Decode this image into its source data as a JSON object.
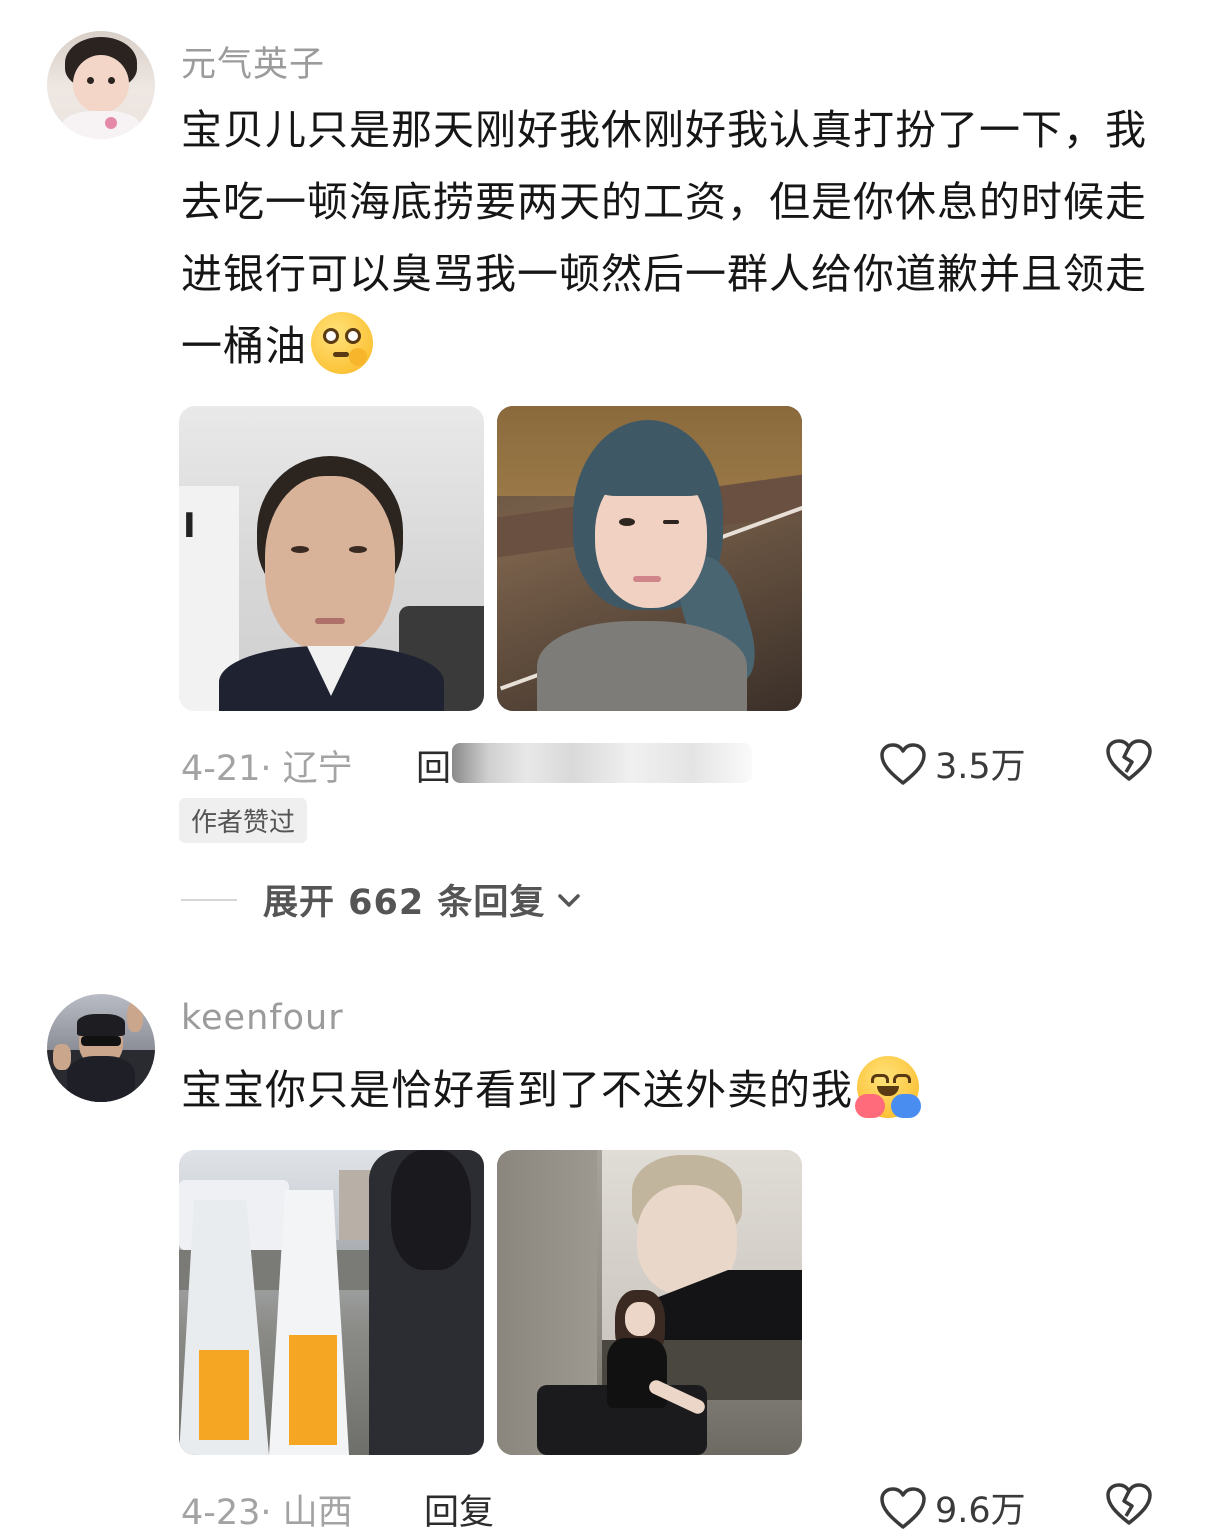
{
  "comments": [
    {
      "username": "元气英子",
      "text": "宝贝儿只是那天刚好我休刚好我认真打扮了一下，我去吃一顿海底捞要两天的工资，但是你休息的时候走进银行可以臭骂我一顿然后一群人给你道歉并且领走一桶油",
      "emoji": "face-with-monocle-emoji",
      "images": [
        "selfie-in-office-photo",
        "selfie-blue-hair-photo"
      ],
      "date_location": "4-21· 辽宁",
      "reply_label": "回",
      "likes": "3.5万",
      "author_liked_badge": "作者赞过",
      "expand_label": "展开 662 条回复",
      "like_icon": "heart-outline-icon",
      "dislike_icon": "broken-heart-icon"
    },
    {
      "username": "keenfour",
      "text": "宝宝你只是恰好看到了不送外卖的我",
      "emoji": "hugging-face-emoji",
      "images": [
        "delivery-bags-photo",
        "poster-seated-woman-photo"
      ],
      "date_location": "4-23· 山西",
      "reply_label": "回复",
      "likes": "9.6万",
      "like_icon": "heart-outline-icon",
      "dislike_icon": "broken-heart-icon"
    }
  ]
}
